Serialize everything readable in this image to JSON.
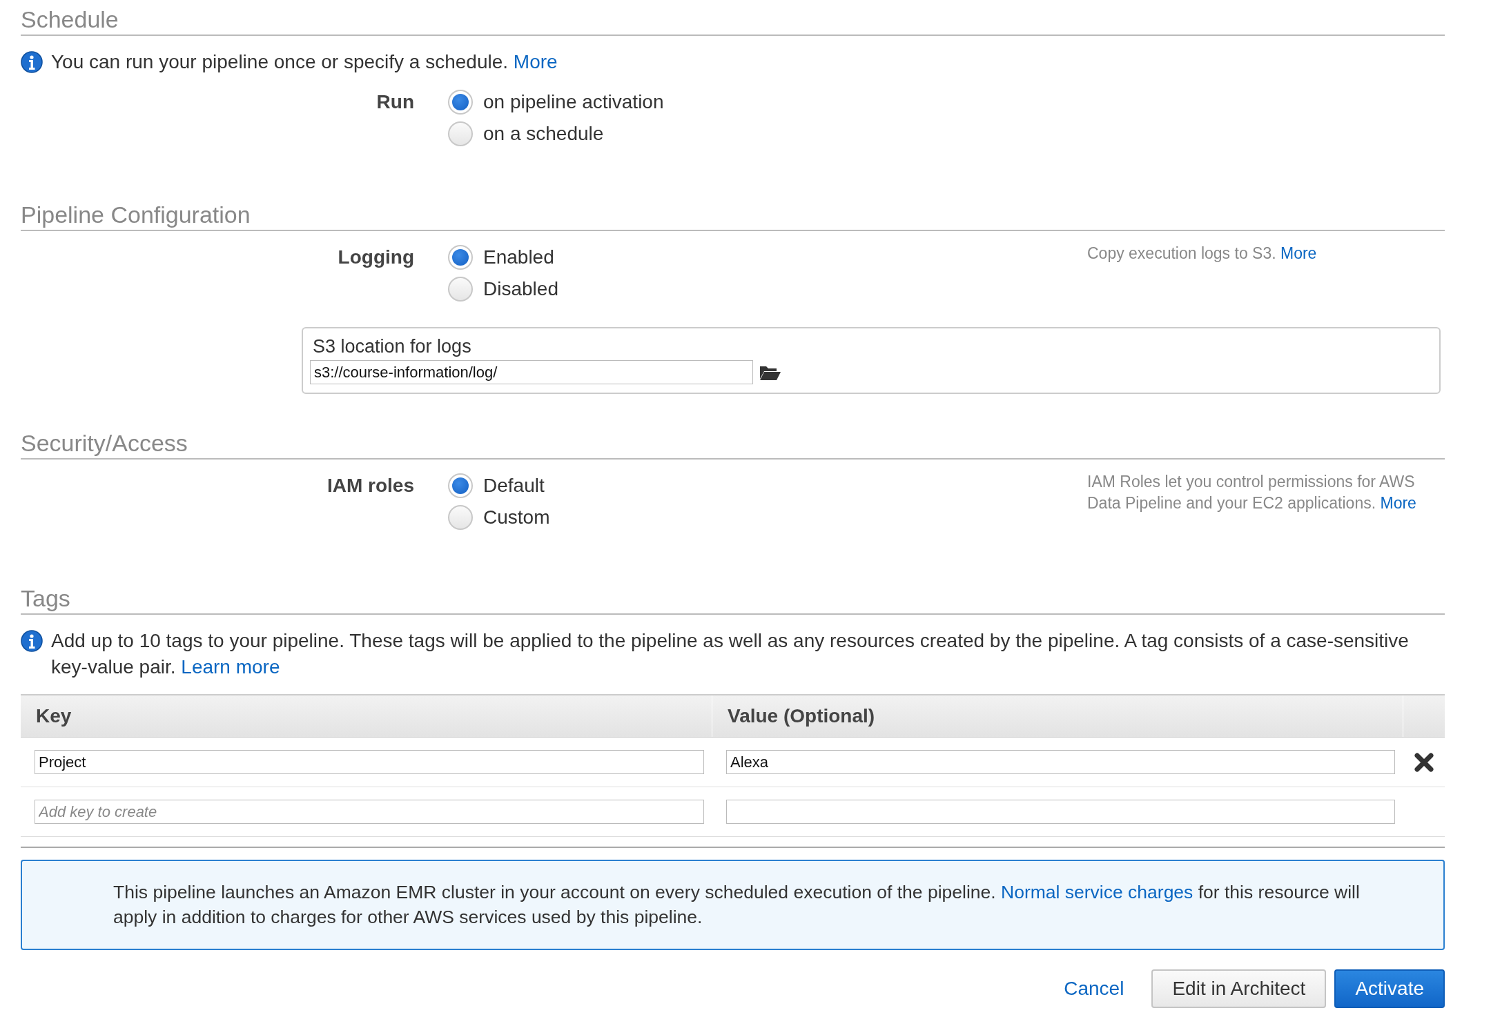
{
  "schedule": {
    "title": "Schedule",
    "info": {
      "text": "You can run your pipeline once or specify a schedule.",
      "link": "More"
    },
    "field": {
      "label": "Run",
      "options": [
        {
          "label": "on pipeline activation",
          "selected": true
        },
        {
          "label": "on a schedule",
          "selected": false
        }
      ]
    }
  },
  "pipeline_configuration": {
    "title": "Pipeline Configuration",
    "field": {
      "label": "Logging",
      "options": [
        {
          "label": "Enabled",
          "selected": true
        },
        {
          "label": "Disabled",
          "selected": false
        }
      ],
      "note": {
        "text": "Copy execution logs to S3.",
        "link": "More"
      }
    },
    "s3_location": {
      "label": "S3 location for logs",
      "value": "s3://course-information/log/"
    }
  },
  "security_access": {
    "title": "Security/Access",
    "field": {
      "label": "IAM roles",
      "options": [
        {
          "label": "Default",
          "selected": true
        },
        {
          "label": "Custom",
          "selected": false
        }
      ],
      "note": {
        "text": "IAM Roles let you control permissions for AWS Data Pipeline and your EC2 applications.",
        "link": "More"
      }
    }
  },
  "tags": {
    "title": "Tags",
    "info": {
      "text": "Add up to 10 tags to your pipeline. These tags will be applied to the pipeline as well as any resources created by the pipeline. A tag consists of a case-sensitive key-value pair.",
      "link": "Learn more"
    },
    "table": {
      "columns": [
        "Key",
        "Value (Optional)"
      ],
      "rows": [
        {
          "key": {
            "value": "Project"
          },
          "value": {
            "value": "Alexa"
          },
          "removable": true
        },
        {
          "key": {
            "placeholder": "Add key to create"
          },
          "value": {},
          "removable": false
        }
      ]
    }
  },
  "notice": {
    "text_before": "This pipeline launches an Amazon EMR cluster in your account on every scheduled execution of the pipeline.",
    "link": "Normal service charges",
    "text_after": "for this resource will apply in addition to charges for other AWS services used by this pipeline."
  },
  "buttons": [
    {
      "label": "Cancel",
      "kind": "link"
    },
    {
      "label": "Edit in Architect",
      "kind": "secondary"
    },
    {
      "label": "Activate",
      "kind": "primary"
    }
  ]
}
